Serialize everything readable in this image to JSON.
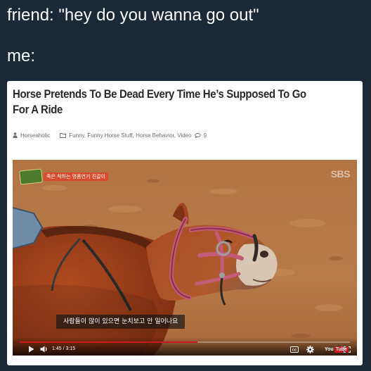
{
  "tweet": {
    "line1": "friend: \"hey do you wanna go out\"",
    "line2": "me:"
  },
  "article": {
    "title": "Horse Pretends To Be Dead Every Time He’s Supposed To Go For A Ride",
    "author": "Horseaholic",
    "categories": "Funny, Funny Horse Stuff, Horse Behavior, Video",
    "comment_count": "9",
    "icons": {
      "author": "person-icon",
      "categories": "folder-icon",
      "comments": "comment-bubble-icon"
    }
  },
  "video": {
    "banner_text": "죽은 척하는 명품연기 진갈이",
    "watermark": "SBS",
    "subtitle": "사람들이 많이 있으면 눈치보고 안 일어나요",
    "time": "1:45 / 3:15",
    "progress_fraction": 0.538,
    "youtube_you": "You",
    "youtube_tube": "Tube",
    "colors": {
      "progress": "#cc181e",
      "banner": "#d94b2f"
    }
  }
}
